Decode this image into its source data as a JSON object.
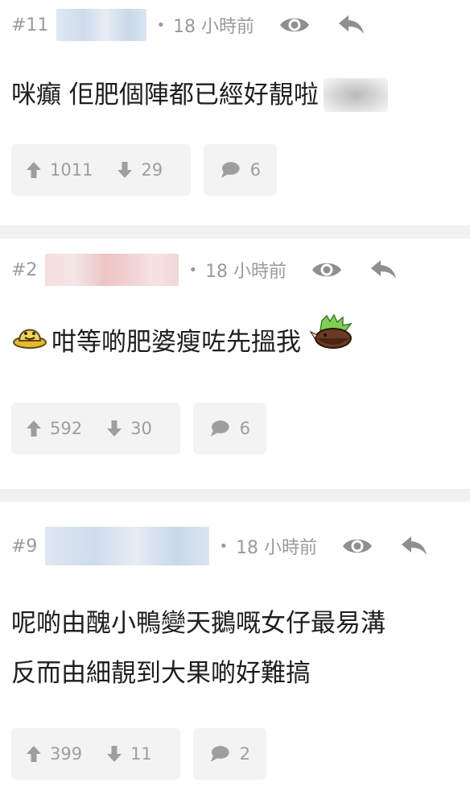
{
  "comments": [
    {
      "number": "#11",
      "time": "18 小時前",
      "text_lines": [
        "咪癲 佢肥個陣都已經好靚啦"
      ],
      "upvotes": "1011",
      "downvotes": "29",
      "replies": "6"
    },
    {
      "number": "#2",
      "time": "18 小時前",
      "text_lines": [
        "咁等啲肥婆瘦咗先搵我"
      ],
      "upvotes": "592",
      "downvotes": "30",
      "replies": "6"
    },
    {
      "number": "#9",
      "time": "18 小時前",
      "text_lines": [
        "呢啲由醜小鴨變天鵝嘅女仔最易溝",
        "反而由細靚到大果啲好難搞"
      ],
      "upvotes": "399",
      "downvotes": "11",
      "replies": "2"
    }
  ],
  "colors": {
    "muted_text": "#9a9a9a",
    "button_bg": "#f3f3f3",
    "separator": "#f1f1f1",
    "body_text": "#1e1e1e"
  },
  "icons": [
    "eye-icon",
    "reply-icon",
    "thumbs-up-arrow-icon",
    "thumbs-down-arrow-icon",
    "comment-bubble-icon"
  ]
}
